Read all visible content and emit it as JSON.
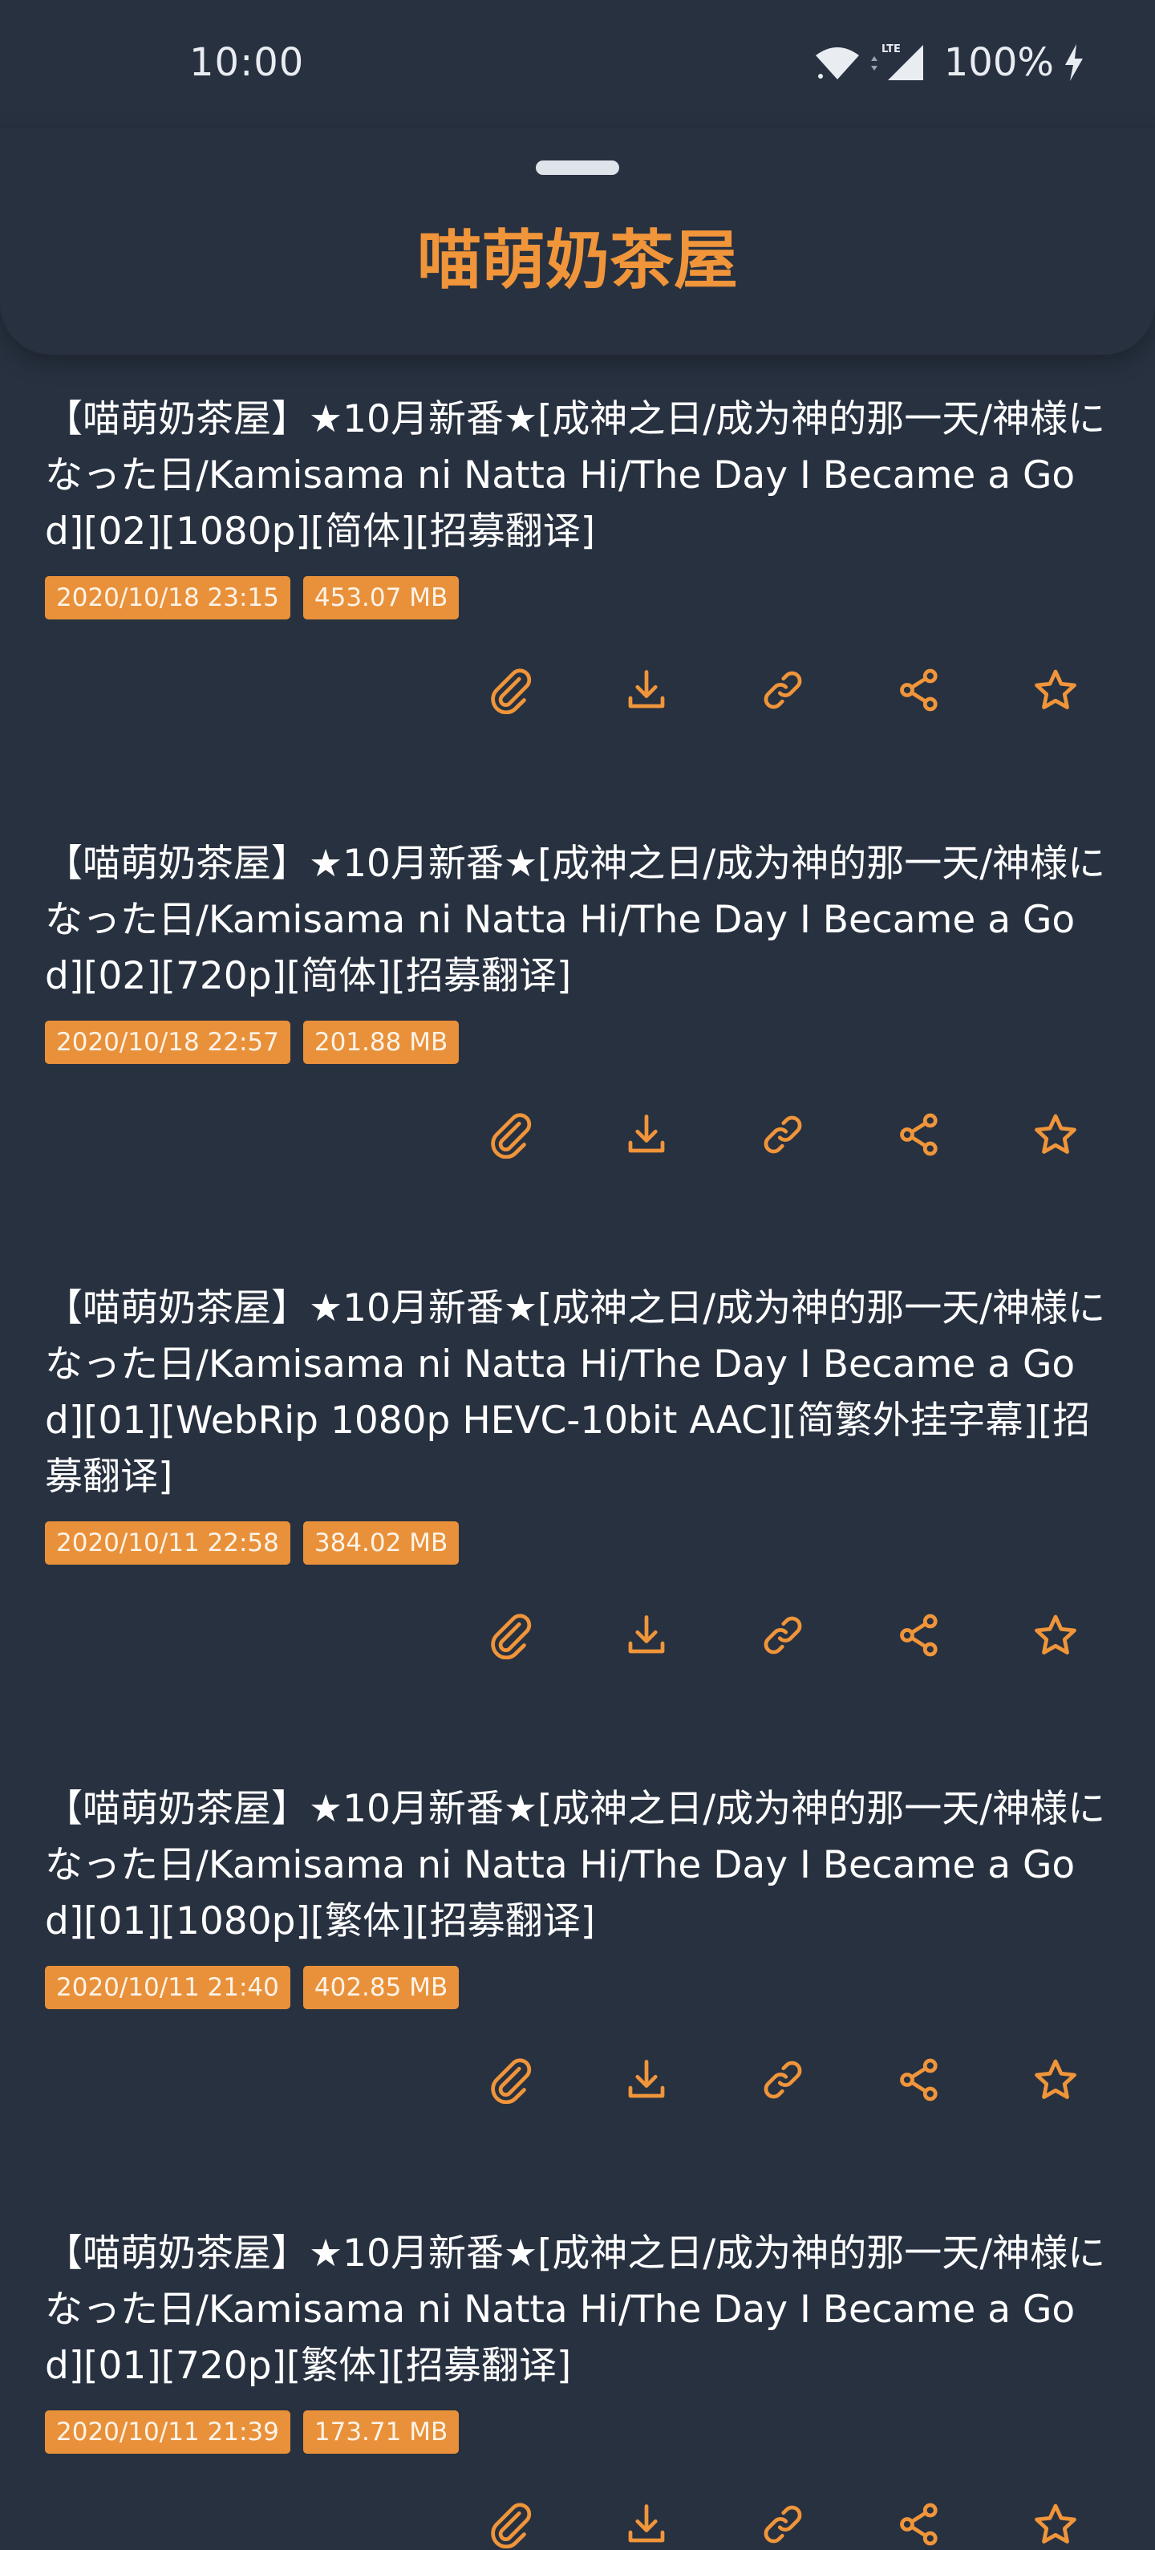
{
  "status_bar": {
    "time": "10:00",
    "network": "LTE",
    "battery": "100%"
  },
  "sheet": {
    "title": "喵萌奶茶屋"
  },
  "actions": [
    {
      "name": "attachment-icon"
    },
    {
      "name": "download-icon"
    },
    {
      "name": "link-icon"
    },
    {
      "name": "share-icon"
    },
    {
      "name": "star-icon"
    }
  ],
  "items": [
    {
      "title": "【喵萌奶茶屋】★10月新番★[成神之日/成为神的那一天/神様になった日/Kamisama ni Natta Hi/The Day I Became a God][02][1080p][简体][招募翻译]",
      "date": "2020/10/18 23:15",
      "size": "453.07 MB"
    },
    {
      "title": "【喵萌奶茶屋】★10月新番★[成神之日/成为神的那一天/神様になった日/Kamisama ni Natta Hi/The Day I Became a God][02][720p][简体][招募翻译]",
      "date": "2020/10/18 22:57",
      "size": "201.88 MB"
    },
    {
      "title": "【喵萌奶茶屋】★10月新番★[成神之日/成为神的那一天/神様になった日/Kamisama ni Natta Hi/The Day I Became a God][01][WebRip 1080p HEVC-10bit AAC][简繁外挂字幕][招募翻译]",
      "date": "2020/10/11 22:58",
      "size": "384.02 MB"
    },
    {
      "title": "【喵萌奶茶屋】★10月新番★[成神之日/成为神的那一天/神様になった日/Kamisama ni Natta Hi/The Day I Became a God][01][1080p][繁体][招募翻译]",
      "date": "2020/10/11 21:40",
      "size": "402.85 MB"
    },
    {
      "title": "【喵萌奶茶屋】★10月新番★[成神之日/成为神的那一天/神様になった日/Kamisama ni Natta Hi/The Day I Became a God][01][720p][繁体][招募翻译]",
      "date": "2020/10/11 21:39",
      "size": "173.71 MB"
    }
  ],
  "colors": {
    "background": "#283140",
    "accent": "#f0953a",
    "badge": "#e9913a",
    "text": "#ffffff"
  }
}
